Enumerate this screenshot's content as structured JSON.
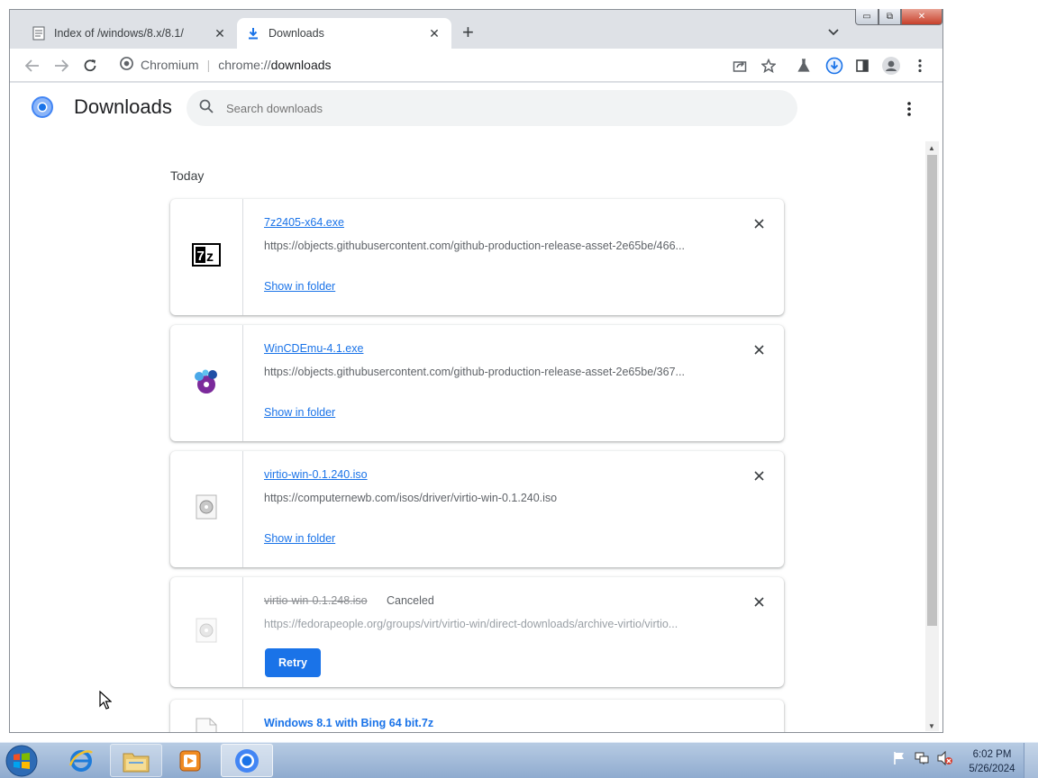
{
  "tabs": [
    {
      "title": "Index of /windows/8.x/8.1/",
      "icon": "document-icon"
    },
    {
      "title": "Downloads",
      "icon": "download-icon"
    }
  ],
  "omnibox": {
    "site_label": "Chromium",
    "scheme": "chrome://",
    "host": "downloads"
  },
  "page": {
    "title": "Downloads",
    "search_placeholder": "Search downloads",
    "section": "Today"
  },
  "downloads": [
    {
      "filename": "7z2405-x64.exe",
      "url": "https://objects.githubusercontent.com/github-production-release-asset-2e65be/466...",
      "action": "Show in folder",
      "icon": "7zip-icon"
    },
    {
      "filename": "WinCDEmu-4.1.exe",
      "url": "https://objects.githubusercontent.com/github-production-release-asset-2e65be/367...",
      "action": "Show in folder",
      "icon": "wincdemu-icon"
    },
    {
      "filename": "virtio-win-0.1.240.iso",
      "url": "https://computernewb.com/isos/driver/virtio-win-0.1.240.iso",
      "action": "Show in folder",
      "icon": "disc-image-icon"
    },
    {
      "filename": "virtio-win-0.1.248.iso",
      "status": "Canceled",
      "url": "https://fedorapeople.org/groups/virt/virtio-win/direct-downloads/archive-virtio/virtio...",
      "action": "Retry",
      "icon": "disc-image-icon"
    },
    {
      "filename": "Windows 8.1 with Bing 64 bit.7z",
      "icon": "file-icon"
    }
  ],
  "taskbar": {
    "apps": [
      "internet-explorer",
      "file-explorer",
      "media-player",
      "chromium"
    ],
    "time": "6:02 PM",
    "date": "5/26/2024"
  },
  "colors": {
    "accent": "#1a73e8",
    "tab_strip": "#dee1e6",
    "taskbar": "#9db4d4"
  }
}
